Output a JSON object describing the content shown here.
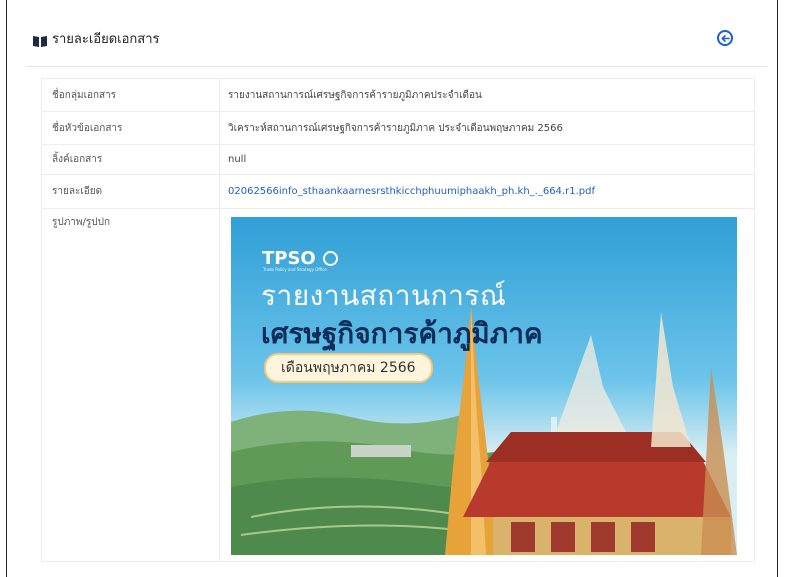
{
  "header": {
    "title": "รายละเอียดเอกสาร",
    "icon": "book-icon",
    "back_icon": "arrow-left-circle-icon"
  },
  "colors": {
    "accent": "#1f5fc8",
    "link": "#1f5fc8"
  },
  "fields": [
    {
      "label": "ชื่อกลุ่มเอกสาร",
      "value": "รายงานสถานการณ์เศรษฐกิจการค้ารายภูมิภาคประจำเดือน"
    },
    {
      "label": "ชื่อหัวข้อเอกสาร",
      "value": "วิเคราะห์สถานการณ์เศรษฐกิจการค้ารายภูมิภาค ประจำเดือนพฤษภาคม 2566"
    },
    {
      "label": "ลิ้งค์เอกสาร",
      "value": "null"
    },
    {
      "label": "รายละเอียด",
      "value": "02062566info_sthaankaarnesrsthkicchphuumiphaakh_ph.kh_._664.r1.pdf"
    },
    {
      "label": "รูปภาพ/รูปปก"
    }
  ],
  "cover": {
    "logo": "TPSO",
    "logo_sub": "Trade Policy and Strategy Office",
    "line1": "รายงานสถานการณ์",
    "line2": "เศรษฐกิจการค้าภูมิภาค",
    "pill": "เดือนพฤษภาคม 2566"
  }
}
